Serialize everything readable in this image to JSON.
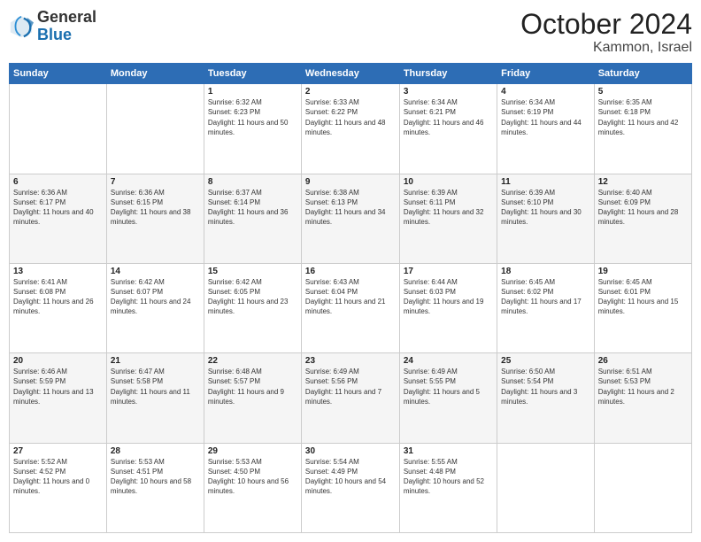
{
  "header": {
    "logo": {
      "general": "General",
      "blue": "Blue"
    },
    "title": "October 2024",
    "location": "Kammon, Israel"
  },
  "weekdays": [
    "Sunday",
    "Monday",
    "Tuesday",
    "Wednesday",
    "Thursday",
    "Friday",
    "Saturday"
  ],
  "rows": [
    [
      {
        "day": "",
        "info": ""
      },
      {
        "day": "",
        "info": ""
      },
      {
        "day": "1",
        "info": "Sunrise: 6:32 AM\nSunset: 6:23 PM\nDaylight: 11 hours and 50 minutes."
      },
      {
        "day": "2",
        "info": "Sunrise: 6:33 AM\nSunset: 6:22 PM\nDaylight: 11 hours and 48 minutes."
      },
      {
        "day": "3",
        "info": "Sunrise: 6:34 AM\nSunset: 6:21 PM\nDaylight: 11 hours and 46 minutes."
      },
      {
        "day": "4",
        "info": "Sunrise: 6:34 AM\nSunset: 6:19 PM\nDaylight: 11 hours and 44 minutes."
      },
      {
        "day": "5",
        "info": "Sunrise: 6:35 AM\nSunset: 6:18 PM\nDaylight: 11 hours and 42 minutes."
      }
    ],
    [
      {
        "day": "6",
        "info": "Sunrise: 6:36 AM\nSunset: 6:17 PM\nDaylight: 11 hours and 40 minutes."
      },
      {
        "day": "7",
        "info": "Sunrise: 6:36 AM\nSunset: 6:15 PM\nDaylight: 11 hours and 38 minutes."
      },
      {
        "day": "8",
        "info": "Sunrise: 6:37 AM\nSunset: 6:14 PM\nDaylight: 11 hours and 36 minutes."
      },
      {
        "day": "9",
        "info": "Sunrise: 6:38 AM\nSunset: 6:13 PM\nDaylight: 11 hours and 34 minutes."
      },
      {
        "day": "10",
        "info": "Sunrise: 6:39 AM\nSunset: 6:11 PM\nDaylight: 11 hours and 32 minutes."
      },
      {
        "day": "11",
        "info": "Sunrise: 6:39 AM\nSunset: 6:10 PM\nDaylight: 11 hours and 30 minutes."
      },
      {
        "day": "12",
        "info": "Sunrise: 6:40 AM\nSunset: 6:09 PM\nDaylight: 11 hours and 28 minutes."
      }
    ],
    [
      {
        "day": "13",
        "info": "Sunrise: 6:41 AM\nSunset: 6:08 PM\nDaylight: 11 hours and 26 minutes."
      },
      {
        "day": "14",
        "info": "Sunrise: 6:42 AM\nSunset: 6:07 PM\nDaylight: 11 hours and 24 minutes."
      },
      {
        "day": "15",
        "info": "Sunrise: 6:42 AM\nSunset: 6:05 PM\nDaylight: 11 hours and 23 minutes."
      },
      {
        "day": "16",
        "info": "Sunrise: 6:43 AM\nSunset: 6:04 PM\nDaylight: 11 hours and 21 minutes."
      },
      {
        "day": "17",
        "info": "Sunrise: 6:44 AM\nSunset: 6:03 PM\nDaylight: 11 hours and 19 minutes."
      },
      {
        "day": "18",
        "info": "Sunrise: 6:45 AM\nSunset: 6:02 PM\nDaylight: 11 hours and 17 minutes."
      },
      {
        "day": "19",
        "info": "Sunrise: 6:45 AM\nSunset: 6:01 PM\nDaylight: 11 hours and 15 minutes."
      }
    ],
    [
      {
        "day": "20",
        "info": "Sunrise: 6:46 AM\nSunset: 5:59 PM\nDaylight: 11 hours and 13 minutes."
      },
      {
        "day": "21",
        "info": "Sunrise: 6:47 AM\nSunset: 5:58 PM\nDaylight: 11 hours and 11 minutes."
      },
      {
        "day": "22",
        "info": "Sunrise: 6:48 AM\nSunset: 5:57 PM\nDaylight: 11 hours and 9 minutes."
      },
      {
        "day": "23",
        "info": "Sunrise: 6:49 AM\nSunset: 5:56 PM\nDaylight: 11 hours and 7 minutes."
      },
      {
        "day": "24",
        "info": "Sunrise: 6:49 AM\nSunset: 5:55 PM\nDaylight: 11 hours and 5 minutes."
      },
      {
        "day": "25",
        "info": "Sunrise: 6:50 AM\nSunset: 5:54 PM\nDaylight: 11 hours and 3 minutes."
      },
      {
        "day": "26",
        "info": "Sunrise: 6:51 AM\nSunset: 5:53 PM\nDaylight: 11 hours and 2 minutes."
      }
    ],
    [
      {
        "day": "27",
        "info": "Sunrise: 5:52 AM\nSunset: 4:52 PM\nDaylight: 11 hours and 0 minutes."
      },
      {
        "day": "28",
        "info": "Sunrise: 5:53 AM\nSunset: 4:51 PM\nDaylight: 10 hours and 58 minutes."
      },
      {
        "day": "29",
        "info": "Sunrise: 5:53 AM\nSunset: 4:50 PM\nDaylight: 10 hours and 56 minutes."
      },
      {
        "day": "30",
        "info": "Sunrise: 5:54 AM\nSunset: 4:49 PM\nDaylight: 10 hours and 54 minutes."
      },
      {
        "day": "31",
        "info": "Sunrise: 5:55 AM\nSunset: 4:48 PM\nDaylight: 10 hours and 52 minutes."
      },
      {
        "day": "",
        "info": ""
      },
      {
        "day": "",
        "info": ""
      }
    ]
  ]
}
